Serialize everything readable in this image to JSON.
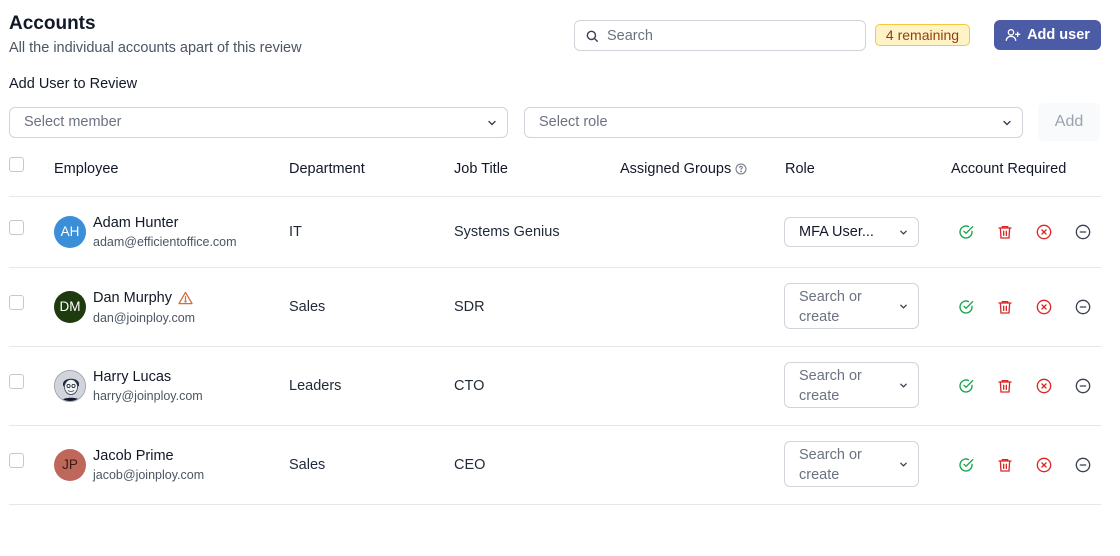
{
  "header": {
    "title": "Accounts",
    "subtitle": "All the individual accounts apart of this review",
    "search_placeholder": "Search",
    "remaining_badge": "4 remaining",
    "add_user_label": "Add user"
  },
  "add_to_review": {
    "label": "Add User to Review",
    "member_placeholder": "Select member",
    "role_placeholder": "Select role",
    "add_label": "Add"
  },
  "table": {
    "columns": [
      "Employee",
      "Department",
      "Job Title",
      "Assigned Groups",
      "Role",
      "Account Required"
    ],
    "rows": [
      {
        "initials": "AH",
        "name": "Adam Hunter",
        "email": "adam@efficientoffice.com",
        "department": "IT",
        "job_title": "Systems Genius",
        "role": "MFA User...",
        "warning": false,
        "avatar_color": "#3b8fd9"
      },
      {
        "initials": "DM",
        "name": "Dan Murphy",
        "email": "dan@joinploy.com",
        "department": "Sales",
        "job_title": "SDR",
        "role_placeholder": "Search or create",
        "warning": true,
        "avatar_color": "#1e3a0f"
      },
      {
        "initials": "",
        "name": "Harry Lucas",
        "email": "harry@joinploy.com",
        "department": "Leaders",
        "job_title": "CTO",
        "role_placeholder": "Search or create",
        "warning": false,
        "avatar_color": "#9ca3af"
      },
      {
        "initials": "JP",
        "name": "Jacob Prime",
        "email": "jacob@joinploy.com",
        "department": "Sales",
        "job_title": "CEO",
        "role_placeholder": "Search or create",
        "warning": false,
        "avatar_color": "#c0675c"
      }
    ]
  },
  "colors": {
    "primary": "#4b5ba6",
    "approve": "#16a34a",
    "delete": "#dc2626",
    "badge_bg": "#fef3c7",
    "badge_text": "#92400e",
    "warning": "#dc6a3a"
  }
}
